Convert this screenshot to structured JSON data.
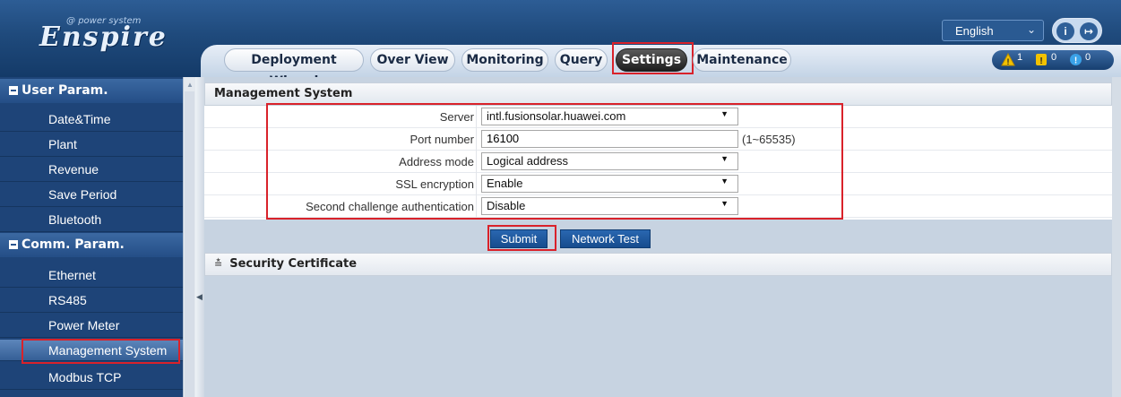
{
  "app": {
    "logo_sub": "power system",
    "logo_main": "Enspire",
    "language": "English"
  },
  "tabs": [
    {
      "label": "Deployment Wizard"
    },
    {
      "label": "Over View"
    },
    {
      "label": "Monitoring"
    },
    {
      "label": "Query"
    },
    {
      "label": "Settings",
      "active": true
    },
    {
      "label": "Maintenance"
    }
  ],
  "alarms": {
    "major": "1",
    "minor": "0",
    "warning": "0",
    "icons": [
      "warning-triangle-icon",
      "minor-alarm-icon",
      "info-alarm-icon"
    ],
    "colors": {
      "major": "#f2c200",
      "minor": "#f2c200",
      "warning": "#3aa2e8"
    }
  },
  "sidebar": {
    "sections": [
      {
        "title": "User Param.",
        "items": [
          "Date&Time",
          "Plant",
          "Revenue",
          "Save Period",
          "Bluetooth"
        ]
      },
      {
        "title": "Comm. Param.",
        "items": [
          "Ethernet",
          "RS485",
          "Power Meter",
          "Management System",
          "Modbus TCP"
        ]
      }
    ],
    "selected": "Management System"
  },
  "panel": {
    "title": "Management System",
    "fields": [
      {
        "label": "Server",
        "value": "intl.fusionsolar.huawei.com",
        "type": "select"
      },
      {
        "label": "Port number",
        "value": "16100",
        "type": "input",
        "hint": "(1~65535)"
      },
      {
        "label": "Address mode",
        "value": "Logical address",
        "type": "select"
      },
      {
        "label": "SSL encryption",
        "value": "Enable",
        "type": "select"
      },
      {
        "label": "Second challenge authentication",
        "value": "Disable",
        "type": "select"
      }
    ],
    "submit_label": "Submit",
    "network_test_label": "Network Test",
    "section2_title": "Security Certificate"
  },
  "theme": {
    "accent": "#1f4a7c",
    "highlight": "#d9222a",
    "button": "#1f5ba0"
  }
}
